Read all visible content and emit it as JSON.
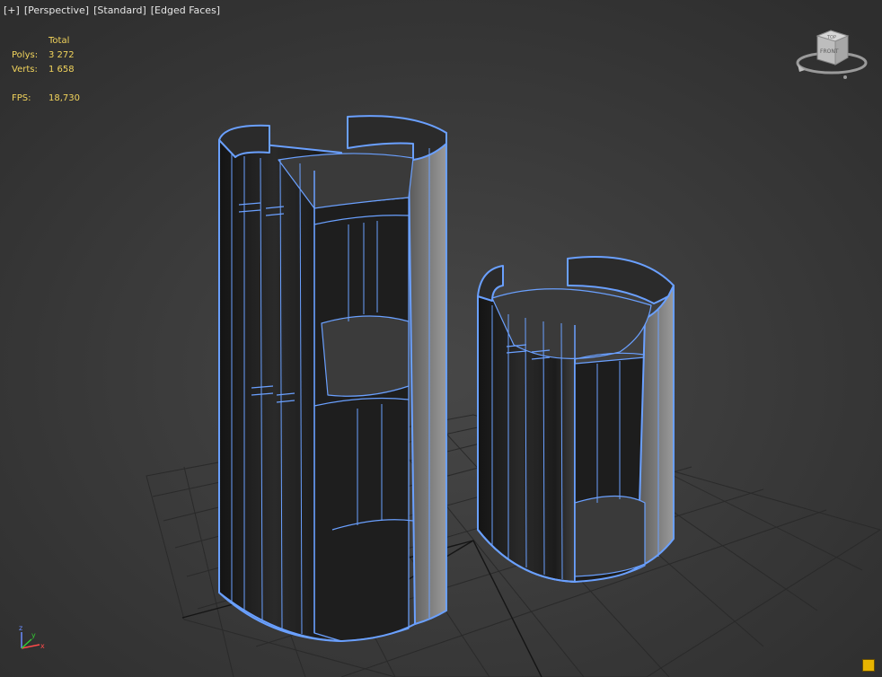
{
  "viewport_menu": {
    "plus": "[+]",
    "view": "[Perspective]",
    "shading": "[Standard]",
    "display": "[Edged Faces]"
  },
  "stats": {
    "header": "Total",
    "polys_label": "Polys:",
    "polys_value": "3 272",
    "verts_label": "Verts:",
    "verts_value": "1 658",
    "fps_label": "FPS:",
    "fps_value": "18,730"
  },
  "viewcube": {
    "front_label": "FRONT",
    "top_label": "TOP"
  },
  "axis_gizmo": {
    "x": "x",
    "y": "y",
    "z": "z"
  },
  "colors": {
    "background": "#3a3a3a",
    "grid": "#2b2b2b",
    "edge_highlight": "#6aa0ff",
    "stats_text": "#f2d45c"
  },
  "icons": {
    "corner_button": "maximize-toggle-icon"
  }
}
